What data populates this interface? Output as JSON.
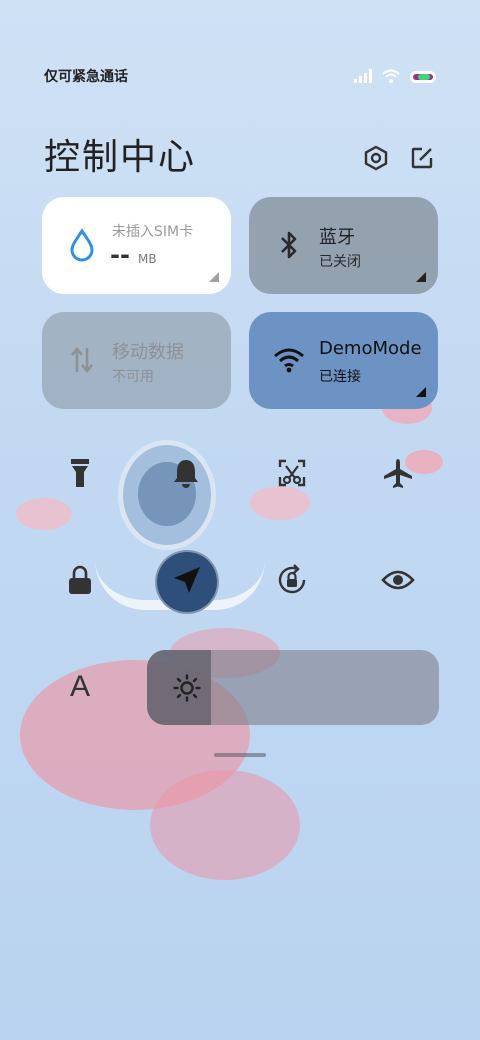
{
  "status_bar": {
    "carrier": "仅可紧急通话",
    "icons": [
      "signal-icon",
      "wifi-icon",
      "battery-icon"
    ]
  },
  "header": {
    "title": "控制中心",
    "icons": [
      "settings-icon",
      "edit-icon"
    ]
  },
  "tiles": {
    "data_usage": {
      "label": "未插入SIM卡",
      "value": "--",
      "unit": "MB",
      "icon": "water-drop-icon",
      "accent": "#2f8fe8"
    },
    "bluetooth": {
      "label": "蓝牙",
      "status": "已关闭",
      "icon": "bluetooth-icon"
    },
    "mobile_data": {
      "label": "移动数据",
      "status": "不可用",
      "icon": "mobile-data-icon"
    },
    "wifi": {
      "label": "DemoMode",
      "status": "已连接",
      "icon": "wifi-icon",
      "accent": "#6d93c4"
    }
  },
  "toggles_row1": [
    "flashlight-icon",
    "bell-icon",
    "screenshot-icon",
    "airplane-icon"
  ],
  "toggles_row2": [
    "lock-icon",
    "location-icon",
    "rotation-lock-icon",
    "eye-icon"
  ],
  "brightness": {
    "font_label": "A",
    "icon": "sun-icon",
    "level": 0.22
  }
}
